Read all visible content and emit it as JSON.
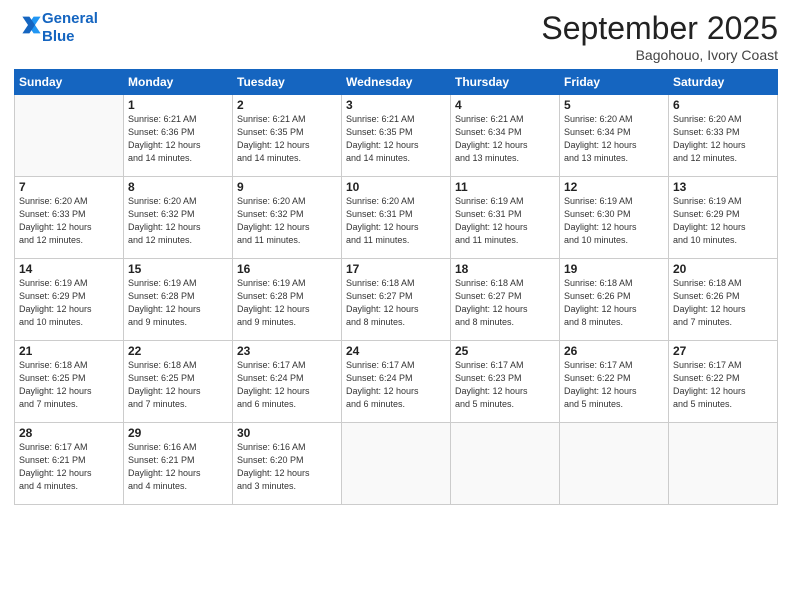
{
  "header": {
    "logo_line1": "General",
    "logo_line2": "Blue",
    "month_title": "September 2025",
    "location": "Bagohouo, Ivory Coast"
  },
  "days_of_week": [
    "Sunday",
    "Monday",
    "Tuesday",
    "Wednesday",
    "Thursday",
    "Friday",
    "Saturday"
  ],
  "weeks": [
    [
      {
        "num": "",
        "info": ""
      },
      {
        "num": "1",
        "info": "Sunrise: 6:21 AM\nSunset: 6:36 PM\nDaylight: 12 hours\nand 14 minutes."
      },
      {
        "num": "2",
        "info": "Sunrise: 6:21 AM\nSunset: 6:35 PM\nDaylight: 12 hours\nand 14 minutes."
      },
      {
        "num": "3",
        "info": "Sunrise: 6:21 AM\nSunset: 6:35 PM\nDaylight: 12 hours\nand 14 minutes."
      },
      {
        "num": "4",
        "info": "Sunrise: 6:21 AM\nSunset: 6:34 PM\nDaylight: 12 hours\nand 13 minutes."
      },
      {
        "num": "5",
        "info": "Sunrise: 6:20 AM\nSunset: 6:34 PM\nDaylight: 12 hours\nand 13 minutes."
      },
      {
        "num": "6",
        "info": "Sunrise: 6:20 AM\nSunset: 6:33 PM\nDaylight: 12 hours\nand 12 minutes."
      }
    ],
    [
      {
        "num": "7",
        "info": "Sunrise: 6:20 AM\nSunset: 6:33 PM\nDaylight: 12 hours\nand 12 minutes."
      },
      {
        "num": "8",
        "info": "Sunrise: 6:20 AM\nSunset: 6:32 PM\nDaylight: 12 hours\nand 12 minutes."
      },
      {
        "num": "9",
        "info": "Sunrise: 6:20 AM\nSunset: 6:32 PM\nDaylight: 12 hours\nand 11 minutes."
      },
      {
        "num": "10",
        "info": "Sunrise: 6:20 AM\nSunset: 6:31 PM\nDaylight: 12 hours\nand 11 minutes."
      },
      {
        "num": "11",
        "info": "Sunrise: 6:19 AM\nSunset: 6:31 PM\nDaylight: 12 hours\nand 11 minutes."
      },
      {
        "num": "12",
        "info": "Sunrise: 6:19 AM\nSunset: 6:30 PM\nDaylight: 12 hours\nand 10 minutes."
      },
      {
        "num": "13",
        "info": "Sunrise: 6:19 AM\nSunset: 6:29 PM\nDaylight: 12 hours\nand 10 minutes."
      }
    ],
    [
      {
        "num": "14",
        "info": "Sunrise: 6:19 AM\nSunset: 6:29 PM\nDaylight: 12 hours\nand 10 minutes."
      },
      {
        "num": "15",
        "info": "Sunrise: 6:19 AM\nSunset: 6:28 PM\nDaylight: 12 hours\nand 9 minutes."
      },
      {
        "num": "16",
        "info": "Sunrise: 6:19 AM\nSunset: 6:28 PM\nDaylight: 12 hours\nand 9 minutes."
      },
      {
        "num": "17",
        "info": "Sunrise: 6:18 AM\nSunset: 6:27 PM\nDaylight: 12 hours\nand 8 minutes."
      },
      {
        "num": "18",
        "info": "Sunrise: 6:18 AM\nSunset: 6:27 PM\nDaylight: 12 hours\nand 8 minutes."
      },
      {
        "num": "19",
        "info": "Sunrise: 6:18 AM\nSunset: 6:26 PM\nDaylight: 12 hours\nand 8 minutes."
      },
      {
        "num": "20",
        "info": "Sunrise: 6:18 AM\nSunset: 6:26 PM\nDaylight: 12 hours\nand 7 minutes."
      }
    ],
    [
      {
        "num": "21",
        "info": "Sunrise: 6:18 AM\nSunset: 6:25 PM\nDaylight: 12 hours\nand 7 minutes."
      },
      {
        "num": "22",
        "info": "Sunrise: 6:18 AM\nSunset: 6:25 PM\nDaylight: 12 hours\nand 7 minutes."
      },
      {
        "num": "23",
        "info": "Sunrise: 6:17 AM\nSunset: 6:24 PM\nDaylight: 12 hours\nand 6 minutes."
      },
      {
        "num": "24",
        "info": "Sunrise: 6:17 AM\nSunset: 6:24 PM\nDaylight: 12 hours\nand 6 minutes."
      },
      {
        "num": "25",
        "info": "Sunrise: 6:17 AM\nSunset: 6:23 PM\nDaylight: 12 hours\nand 5 minutes."
      },
      {
        "num": "26",
        "info": "Sunrise: 6:17 AM\nSunset: 6:22 PM\nDaylight: 12 hours\nand 5 minutes."
      },
      {
        "num": "27",
        "info": "Sunrise: 6:17 AM\nSunset: 6:22 PM\nDaylight: 12 hours\nand 5 minutes."
      }
    ],
    [
      {
        "num": "28",
        "info": "Sunrise: 6:17 AM\nSunset: 6:21 PM\nDaylight: 12 hours\nand 4 minutes."
      },
      {
        "num": "29",
        "info": "Sunrise: 6:16 AM\nSunset: 6:21 PM\nDaylight: 12 hours\nand 4 minutes."
      },
      {
        "num": "30",
        "info": "Sunrise: 6:16 AM\nSunset: 6:20 PM\nDaylight: 12 hours\nand 3 minutes."
      },
      {
        "num": "",
        "info": ""
      },
      {
        "num": "",
        "info": ""
      },
      {
        "num": "",
        "info": ""
      },
      {
        "num": "",
        "info": ""
      }
    ]
  ]
}
